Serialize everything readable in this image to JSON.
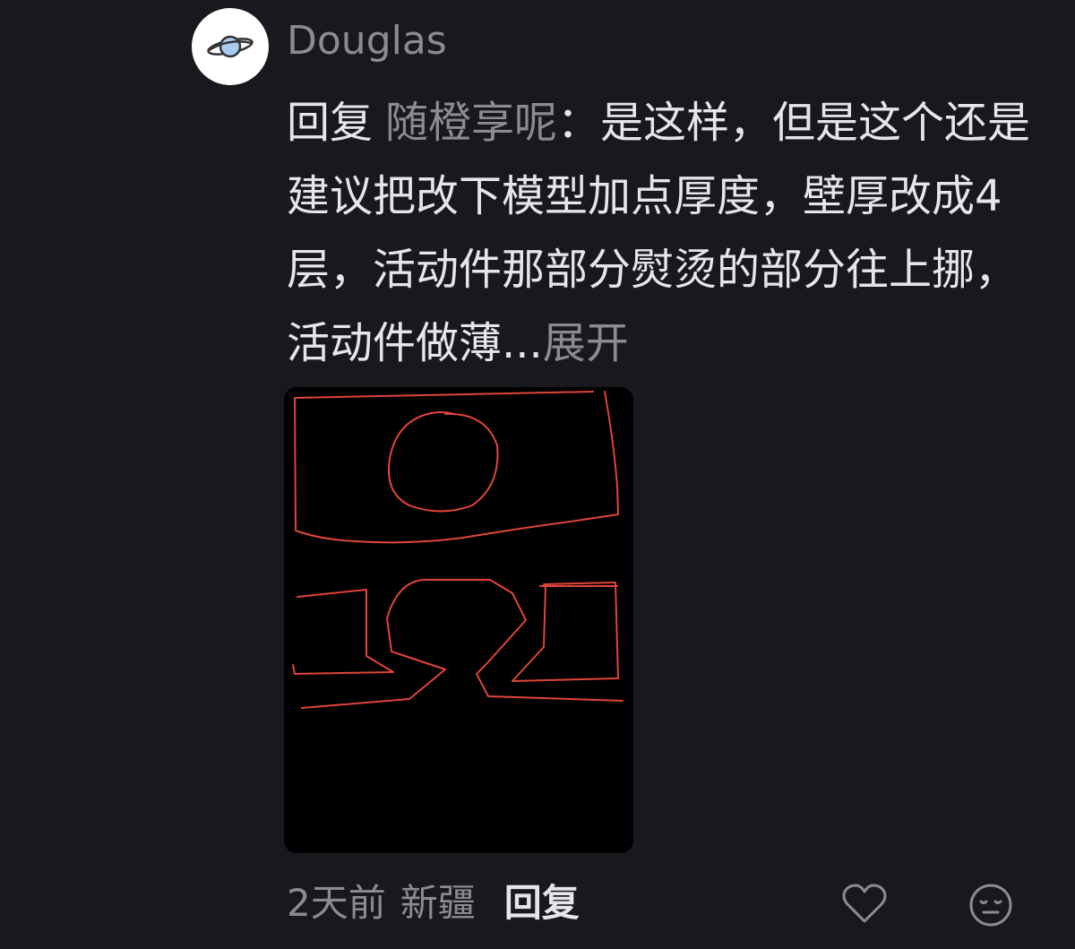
{
  "comment": {
    "author": "Douglas",
    "avatar_icon": "planet-icon",
    "reply_label": "回复",
    "reply_target": "随橙享呢",
    "text": "：是这样，但是这个还是建议把改下模型加点厚度，壁厚改成4层，活动件那部分熨烫的部分往上挪，活动件做薄...",
    "expand_label": "展开",
    "image_icon": "sketch-image",
    "time": "2天前",
    "location": "新疆",
    "reply_button": "回复",
    "like_icon": "heart-icon",
    "reaction_icon": "emoji-face-icon"
  },
  "colors": {
    "background": "#19181e",
    "primary_text": "#e6e6ea",
    "secondary_text": "#8c8b92",
    "sketch_stroke": "#e0443a"
  }
}
